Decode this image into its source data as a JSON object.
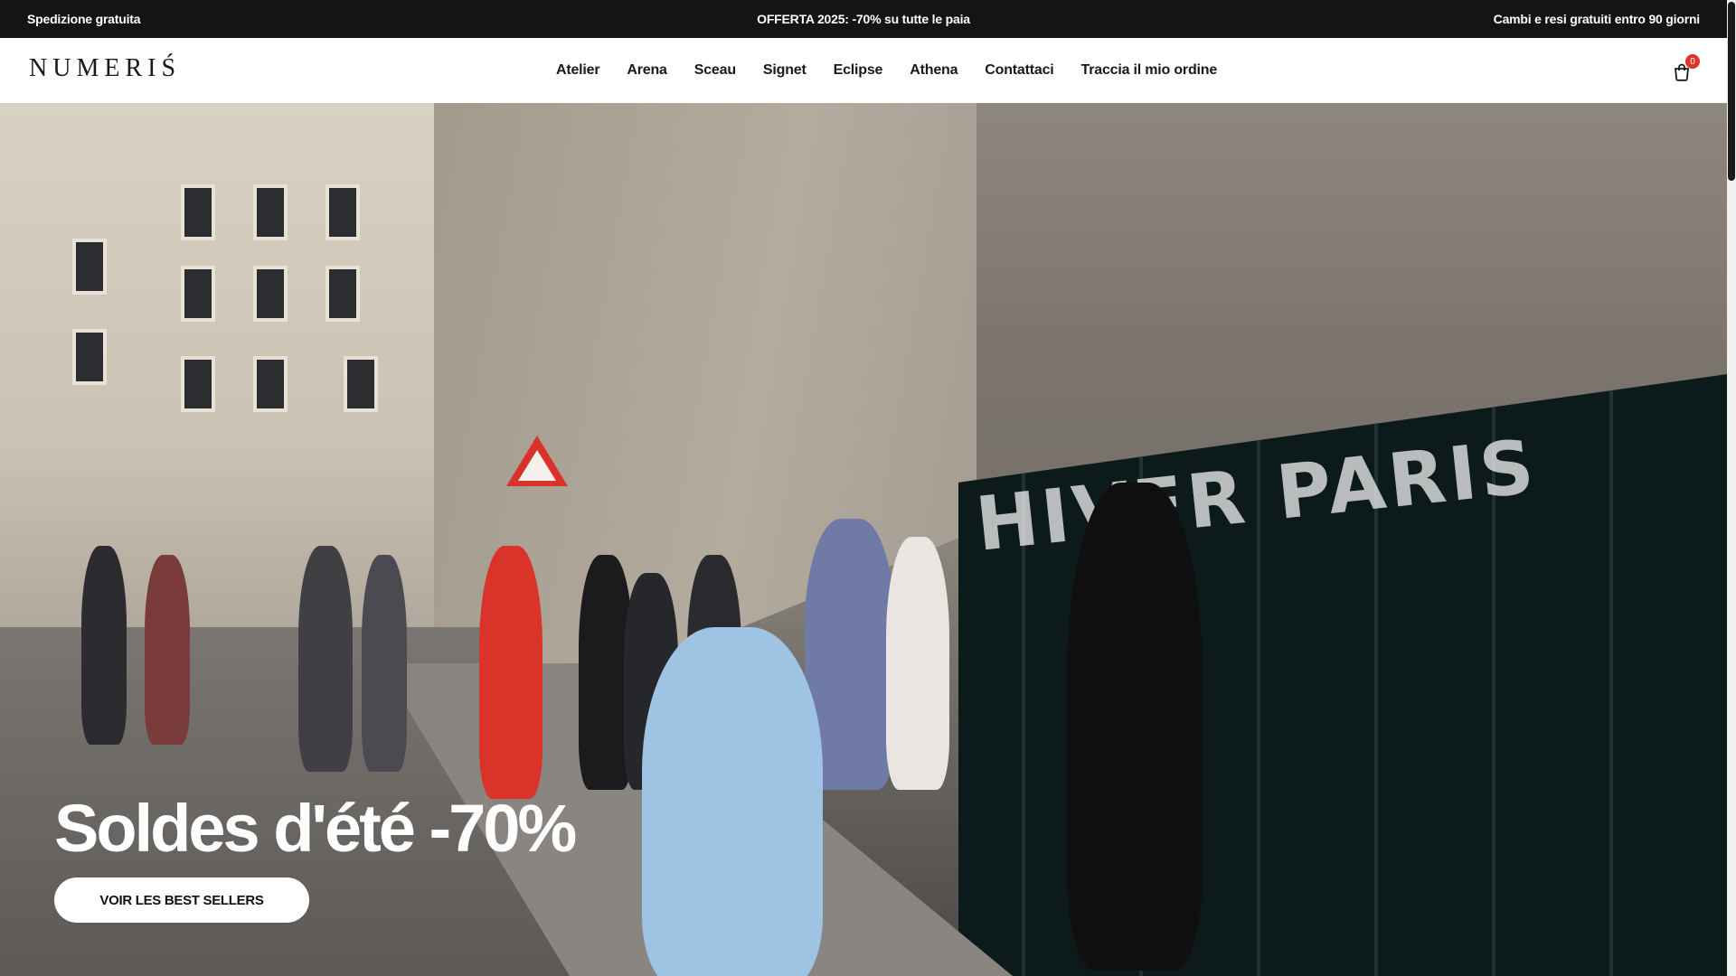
{
  "announcement": {
    "left": "Spedizione gratuita",
    "center": "OFFERTA 2025: -70% su tutte le paia",
    "right": "Cambi e resi gratuiti entro 90 giorni"
  },
  "header": {
    "logo": "NUMERIŚ",
    "nav": [
      "Atelier",
      "Arena",
      "Sceau",
      "Signet",
      "Eclipse",
      "Athena",
      "Contattaci",
      "Traccia il mio ordine"
    ],
    "cart_count": "0"
  },
  "hero": {
    "title": "Soldes d'été -70%",
    "button_label": "VOIR LES BEST SELLERS",
    "wall_text": "HIVER PARIS"
  },
  "colors": {
    "announce_bg": "#141414",
    "badge": "#e0322b",
    "storefront": "#0d1a1c"
  },
  "icons": [
    "cart-icon"
  ]
}
